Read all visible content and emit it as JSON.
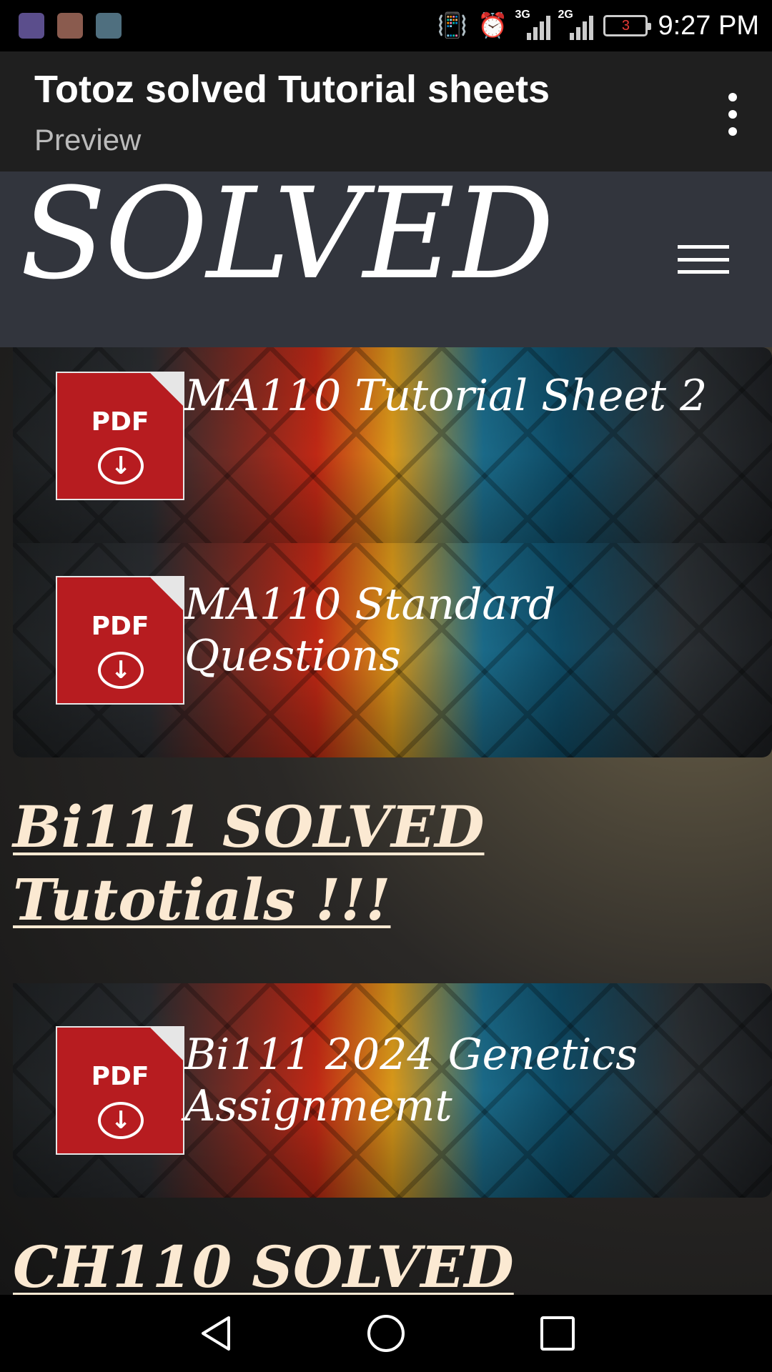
{
  "status_bar": {
    "time": "9:27 PM",
    "battery_level": "3",
    "network_1": "3G",
    "network_2": "2G",
    "notification_icons": [
      "app-icon",
      "clipboard-icon",
      "gallery-icon"
    ]
  },
  "app_bar": {
    "title": "Totoz solved Tutorial sheets",
    "subtitle": "Preview"
  },
  "site_header": {
    "logo_text": "SOLVED"
  },
  "content": {
    "cards": [
      {
        "icon_label": "PDF",
        "title": "MA110 Tutorial Sheet 2"
      },
      {
        "icon_label": "PDF",
        "title": "MA110 Standard Questions"
      },
      {
        "icon_label": "PDF",
        "title": "Bi111 2024 Genetics Assignmemt"
      }
    ],
    "headings": [
      "Bi111 SOLVED Tutotials !!!",
      "CH110 SOLVED"
    ]
  },
  "colors": {
    "pdf_red": "#b71c20",
    "heading_cream": "#fbe9d2",
    "header_bg": "#32353d",
    "appbar_bg": "#1f1f1f"
  }
}
